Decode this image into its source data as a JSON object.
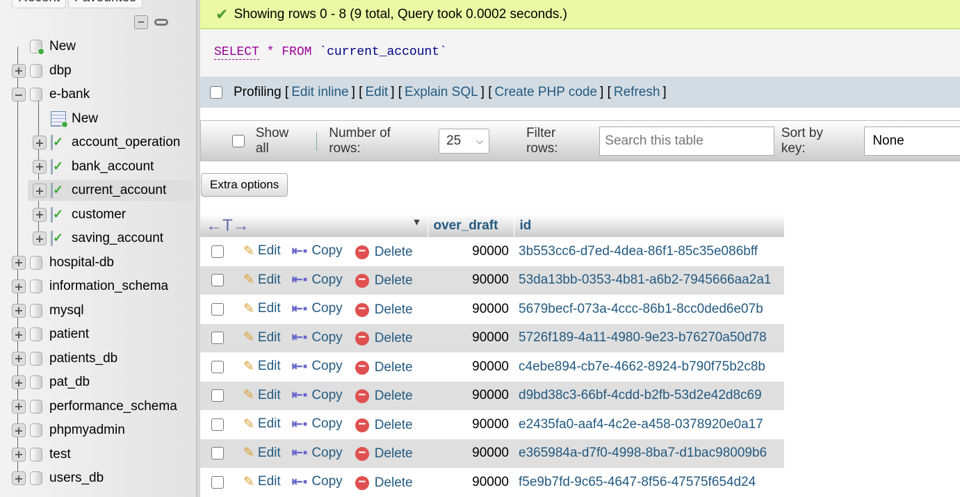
{
  "sidebar": {
    "recent": "Recent",
    "favourites": "Favourites",
    "items": [
      {
        "label": "New",
        "type": "new-db",
        "level": 0
      },
      {
        "label": "dbp",
        "type": "db",
        "level": 0
      },
      {
        "label": "e-bank",
        "type": "db",
        "level": 0,
        "expanded": true
      },
      {
        "label": "New",
        "type": "new-table",
        "level": 1
      },
      {
        "label": "account_operation",
        "type": "table",
        "level": 1
      },
      {
        "label": "bank_account",
        "type": "table",
        "level": 1
      },
      {
        "label": "current_account",
        "type": "table",
        "level": 1,
        "selected": true
      },
      {
        "label": "customer",
        "type": "table",
        "level": 1
      },
      {
        "label": "saving_account",
        "type": "table",
        "level": 1
      },
      {
        "label": "hospital-db",
        "type": "db",
        "level": 0
      },
      {
        "label": "information_schema",
        "type": "db",
        "level": 0
      },
      {
        "label": "mysql",
        "type": "db",
        "level": 0
      },
      {
        "label": "patient",
        "type": "db",
        "level": 0
      },
      {
        "label": "patients_db",
        "type": "db",
        "level": 0
      },
      {
        "label": "pat_db",
        "type": "db",
        "level": 0
      },
      {
        "label": "performance_schema",
        "type": "db",
        "level": 0
      },
      {
        "label": "phpmyadmin",
        "type": "db",
        "level": 0
      },
      {
        "label": "test",
        "type": "db",
        "level": 0
      },
      {
        "label": "users_db",
        "type": "db",
        "level": 0
      }
    ]
  },
  "message": "Showing rows 0 - 8 (9 total, Query took 0.0002 seconds.)",
  "sql": {
    "select": "SELECT",
    "star": "*",
    "from": "FROM",
    "table": "`current_account`"
  },
  "profiling": {
    "label": "Profiling",
    "links": [
      "Edit inline",
      "Edit",
      "Explain SQL",
      "Create PHP code",
      "Refresh"
    ]
  },
  "nav": {
    "show_all": "Show all",
    "rows_label": "Number of rows:",
    "rows_value": "25",
    "filter_label": "Filter rows:",
    "filter_placeholder": "Search this table",
    "sort_label": "Sort by key:",
    "sort_value": "None"
  },
  "extra_options": "Extra options",
  "table": {
    "columns": [
      "over_draft",
      "id"
    ],
    "actions": {
      "edit": "Edit",
      "copy": "Copy",
      "delete": "Delete"
    },
    "rows": [
      [
        "90000",
        "3b553cc6-d7ed-4dea-86f1-85c35e086bff"
      ],
      [
        "90000",
        "53da13bb-0353-4b81-a6b2-7945666aa2a1"
      ],
      [
        "90000",
        "5679becf-073a-4ccc-86b1-8cc0ded6e07b"
      ],
      [
        "90000",
        "5726f189-4a11-4980-9e23-b76270a50d78"
      ],
      [
        "90000",
        "c4ebe894-cb7e-4662-8924-b790f75b2c8b"
      ],
      [
        "90000",
        "d9bd38c3-66bf-4cdd-b2fb-53d2e42d8c69"
      ],
      [
        "90000",
        "e2435fa0-aaf4-4c2e-a458-0378920e0a17"
      ],
      [
        "90000",
        "e365984a-d7f0-4998-8ba7-d1bac98009b6"
      ],
      [
        "90000",
        "f5e9b7fd-9c65-4647-8f56-47575f654d24"
      ]
    ]
  }
}
